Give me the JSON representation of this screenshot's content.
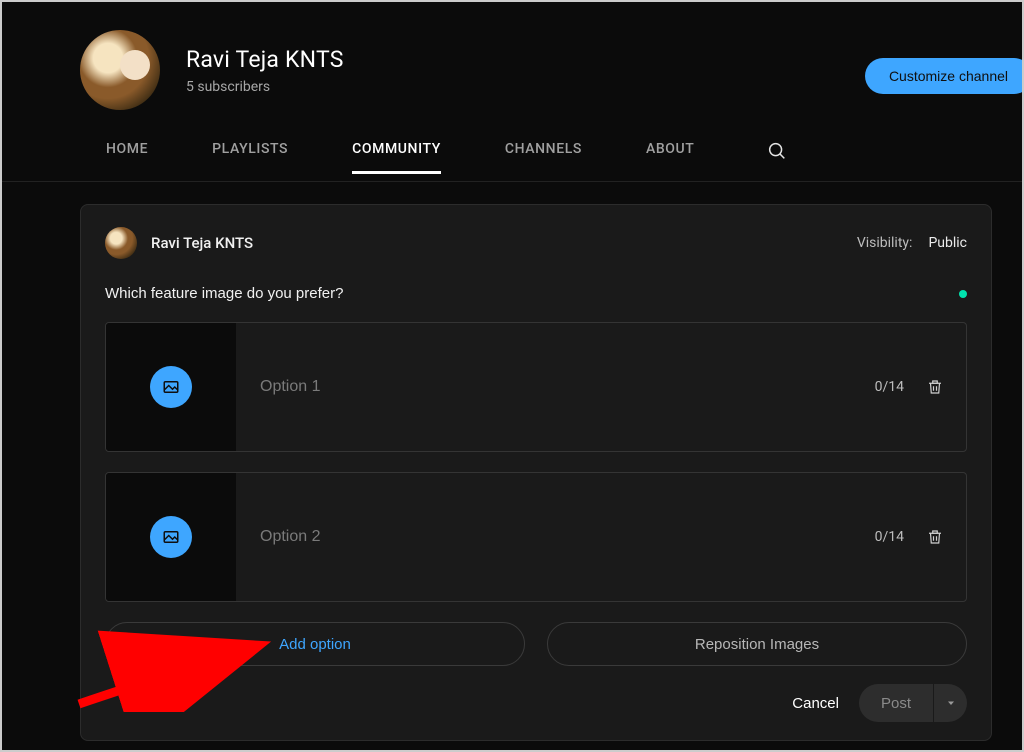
{
  "channel": {
    "name": "Ravi Teja KNTS",
    "subscribers": "5 subscribers",
    "customize_label": "Customize channel"
  },
  "tabs": {
    "home": "HOME",
    "playlists": "PLAYLISTS",
    "community": "COMMUNITY",
    "channels": "CHANNELS",
    "about": "ABOUT"
  },
  "composer": {
    "author": "Ravi Teja KNTS",
    "visibility_label": "Visibility:",
    "visibility_value": "Public",
    "question": "Which feature image do you prefer?",
    "options": [
      {
        "placeholder": "Option 1",
        "count": "0/14"
      },
      {
        "placeholder": "Option 2",
        "count": "0/14"
      }
    ],
    "add_option_label": "Add option",
    "reposition_label": "Reposition Images",
    "cancel_label": "Cancel",
    "post_label": "Post"
  }
}
